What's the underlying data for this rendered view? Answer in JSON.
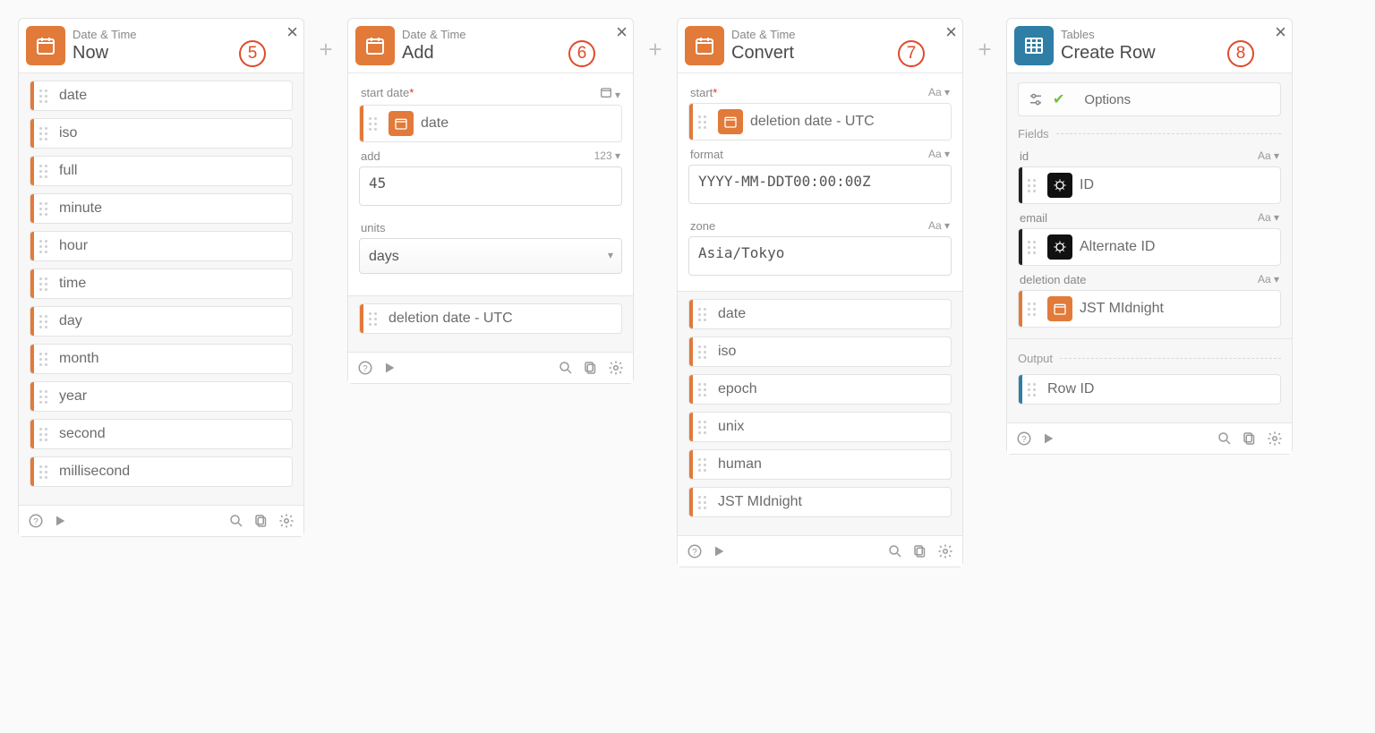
{
  "connectors": {
    "plus": "+"
  },
  "cards": [
    {
      "id": "now",
      "category": "Date & Time",
      "title": "Now",
      "badge": "5",
      "outputs": [
        "date",
        "iso",
        "full",
        "minute",
        "hour",
        "time",
        "day",
        "month",
        "year",
        "second",
        "millisecond"
      ]
    },
    {
      "id": "add",
      "category": "Date & Time",
      "title": "Add",
      "badge": "6",
      "fields": {
        "start_date": {
          "label": "start date",
          "required": true,
          "hint_icon": "calendar",
          "value_pill": "date"
        },
        "add": {
          "label": "add",
          "hint": "123",
          "value": "45"
        },
        "units": {
          "label": "units",
          "value": "days"
        }
      },
      "outputs": [
        "deletion date - UTC"
      ]
    },
    {
      "id": "convert",
      "category": "Date & Time",
      "title": "Convert",
      "badge": "7",
      "fields": {
        "start": {
          "label": "start",
          "required": true,
          "hint": "Aa",
          "value_pill": "deletion date - UTC"
        },
        "format": {
          "label": "format",
          "hint": "Aa",
          "value": "YYYY-MM-DDT00:00:00Z"
        },
        "zone": {
          "label": "zone",
          "hint": "Aa",
          "value": "Asia/Tokyo"
        }
      },
      "outputs": [
        "date",
        "iso",
        "epoch",
        "unix",
        "human",
        "JST MIdnight"
      ]
    },
    {
      "id": "createrow",
      "category": "Tables",
      "title": "Create Row",
      "badge": "8",
      "options_label": "Options",
      "section_fields_label": "Fields",
      "section_output_label": "Output",
      "fields": {
        "id": {
          "label": "id",
          "hint": "Aa",
          "value_pill": "ID",
          "pill_style": "dark"
        },
        "email": {
          "label": "email",
          "hint": "Aa",
          "value_pill": "Alternate ID",
          "pill_style": "dark"
        },
        "deletion_date": {
          "label": "deletion date",
          "hint": "Aa",
          "value_pill": "JST MIdnight",
          "pill_style": "orange"
        }
      },
      "outputs": [
        {
          "label": "Row ID",
          "stripe": "blue"
        }
      ]
    }
  ]
}
